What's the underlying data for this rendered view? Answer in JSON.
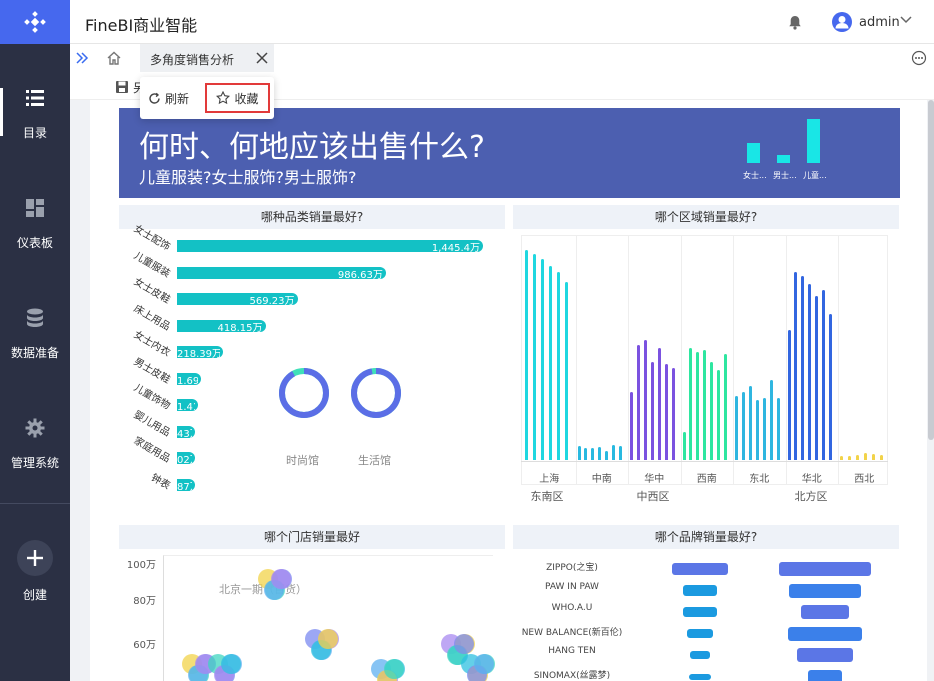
{
  "app": {
    "title": "FineBI商业智能"
  },
  "user": {
    "name": "admin"
  },
  "sidebar": {
    "items": [
      {
        "label": "目录",
        "icon": "list-icon"
      },
      {
        "label": "仪表板",
        "icon": "dashboard-icon"
      },
      {
        "label": "数据准备",
        "icon": "database-icon"
      },
      {
        "label": "管理系统",
        "icon": "gear-icon"
      },
      {
        "label": "创建",
        "icon": "plus-icon"
      }
    ]
  },
  "tab": {
    "label": "多角度销售分析"
  },
  "toolbar": {
    "save_stub": "另"
  },
  "menu": {
    "refresh": "刷新",
    "favorite": "收藏"
  },
  "banner": {
    "title": "何时、何地应该出售什么?",
    "subtitle": "儿童服装?女士服饰?男士服饰?",
    "bars": [
      {
        "label": "女士...",
        "value": 20
      },
      {
        "label": "男士...",
        "value": 8
      },
      {
        "label": "儿童...",
        "value": 44
      }
    ]
  },
  "panels": {
    "category": {
      "title": "哪种品类销量最好?"
    },
    "region": {
      "title": "哪个区域销量最好?"
    },
    "store": {
      "title": "哪个门店销量最好"
    },
    "brand": {
      "title": "哪个品牌销量最好?"
    }
  },
  "chart_data": [
    {
      "type": "bar",
      "orientation": "horizontal",
      "title": "哪种品类销量最好?",
      "categories": [
        "女士配饰",
        "儿童服装",
        "女士皮鞋",
        "床上用品",
        "女士内衣",
        "男士皮鞋",
        "儿童饰物",
        "婴儿用品",
        "家庭用品",
        "钟表"
      ],
      "values": [
        1445.4,
        986.63,
        569.23,
        418.15,
        218.39,
        111.69,
        100.41,
        80.43,
        75.02,
        70.87
      ],
      "value_labels": [
        "1,445.4万",
        "986.63万",
        "569.23万",
        "418.15万",
        "218.39万",
        "1.69万",
        "1.41万",
        "43万",
        "02万",
        "87万"
      ],
      "donuts": [
        {
          "name": "时尚馆",
          "fraction": 0.92
        },
        {
          "name": "生活馆",
          "fraction": 0.97
        }
      ]
    },
    {
      "type": "bar",
      "title": "哪个区域销量最好?",
      "categories": [
        "上海",
        "中南",
        "华中",
        "西南",
        "东北",
        "华北",
        "西北"
      ],
      "groups": [
        {
          "name": "东南区",
          "categories": [
            "上海"
          ]
        },
        {
          "name": "中西区",
          "categories": [
            "中南",
            "华中",
            "西南"
          ]
        },
        {
          "name": "北方区",
          "categories": [
            "东北",
            "华北",
            "西北"
          ]
        }
      ],
      "series_colors": {
        "上海": "#1fd7e0",
        "中南": "#28b9e0",
        "华中": "#7b52e0",
        "西南": "#2ee6a0",
        "东北": "#2fb6e0",
        "华北": "#3266e0",
        "西北": "#f2d34a"
      },
      "series_values": {
        "上海": [
          210,
          206,
          201,
          194,
          188,
          178
        ],
        "中南": [
          14,
          12,
          12,
          13,
          9,
          15,
          14
        ],
        "华中": [
          68,
          115,
          120,
          98,
          112,
          96,
          92
        ],
        "西南": [
          28,
          112,
          108,
          110,
          98,
          90,
          106
        ],
        "东北": [
          64,
          68,
          74,
          60,
          62,
          80,
          62
        ],
        "华北": [
          130,
          188,
          184,
          176,
          164,
          170,
          146
        ],
        "西北": [
          4,
          4,
          5,
          7,
          6,
          5
        ]
      }
    },
    {
      "type": "scatter",
      "title": "哪个门店销量最好",
      "yticks": [
        "100万",
        "80万",
        "60万"
      ],
      "annotation": "北京一期（百货）"
    },
    {
      "type": "bar",
      "orientation": "horizontal",
      "title": "哪个品牌销量最好?",
      "categories": [
        "ZIPPO(之宝)",
        "PAW IN PAW",
        "WHO.A.U",
        "NEW BALANCE(新百伦)",
        "HANG TEN",
        "SINOMAX(丝露梦)"
      ],
      "series": [
        {
          "values": [
            56,
            34,
            34,
            26,
            20,
            22
          ]
        },
        {
          "values": [
            92,
            72,
            48,
            74,
            56,
            34
          ]
        }
      ]
    }
  ]
}
